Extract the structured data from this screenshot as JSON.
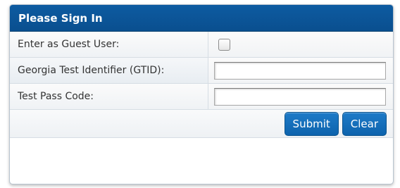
{
  "header": {
    "title": "Please Sign In"
  },
  "form": {
    "guest_label": "Enter as Guest User:",
    "gtid_label": "Georgia Test Identifier (GTID):",
    "gtid_value": "",
    "passcode_label": "Test Pass Code:",
    "passcode_value": ""
  },
  "buttons": {
    "submit": "Submit",
    "clear": "Clear"
  },
  "colors": {
    "header_bg": "#0a4f8f",
    "button_bg": "#1870bb"
  }
}
